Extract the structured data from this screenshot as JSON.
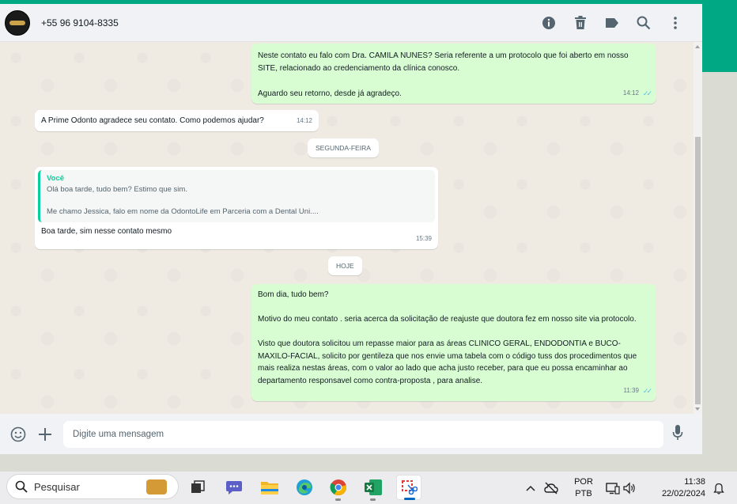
{
  "header": {
    "contact_name": "+55 96 9104-8335",
    "icons": [
      "info-icon",
      "trash-icon",
      "label-icon",
      "search-icon",
      "menu-icon"
    ]
  },
  "messages": [
    {
      "direction": "out",
      "text": "Neste contato eu falo com Dra. CAMILA NUNES? Seria referente a um protocolo que foi aberto em nosso SITE, relacionado ao credenciamento da clínica conosco.\n\nAguardo seu retorno, desde já agradeço.",
      "time": "14:12",
      "status": "read"
    },
    {
      "direction": "in",
      "text": "A Prime Odonto agradece seu contato. Como podemos ajudar?",
      "time": "14:12"
    },
    {
      "direction": "in",
      "quote": {
        "author": "Você",
        "text": "Olá boa tarde, tudo bem? Estimo que sim.\n\nMe chamo Jessica, falo em nome da OdontoLife em Parceria com a Dental Uni...."
      },
      "text": "Boa tarde, sim nesse contato mesmo",
      "time": "15:39"
    },
    {
      "direction": "out",
      "text": "Bom dia, tudo bem?\n\nMotivo do meu contato . seria acerca da solicitação de reajuste que doutora fez em nosso site via protocolo.\n\nVisto que doutora solicitou um repasse maior para as áreas CLINICO GERAL, ENDODONTIA e BUCO-MAXILO-FACIAL, solicito por gentileza que nos envie uma tabela com o código tuss dos procedimentos que mais realiza nestas áreas, com o valor ao lado que acha justo receber, para que eu possa encaminhar ao departamento responsavel como contra-proposta , para analise.",
      "time": "11:39",
      "status": "read"
    }
  ],
  "date_separators": [
    "SEGUNDA-FEIRA",
    "HOJE"
  ],
  "composer": {
    "placeholder": "Digite uma mensagem"
  },
  "taskbar": {
    "search_label": "Pesquisar",
    "language_top": "POR",
    "language_bottom": "PTB",
    "time": "11:38",
    "date": "22/02/2024"
  },
  "colors": {
    "accent": "#00a884",
    "outgoing_bubble": "#d9fdd3",
    "incoming_bubble": "#ffffff",
    "read_ticks": "#53bdeb"
  }
}
